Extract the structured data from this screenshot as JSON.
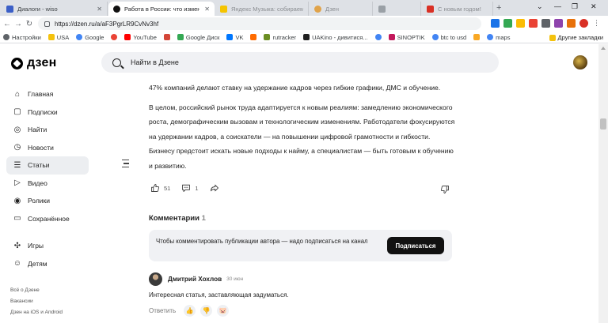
{
  "browser": {
    "tabs": [
      {
        "title": "Диалоги - wiso",
        "active": false
      },
      {
        "title": "Работа в России: что изменилось",
        "active": true
      },
      {
        "title": "Яндекс Музыка: собираем музы",
        "active": false
      },
      {
        "title": "Дзен",
        "active": false
      },
      {
        "title": "",
        "active": false
      },
      {
        "title": "С новым годом!",
        "active": false
      }
    ],
    "new_tab": "+",
    "url": "https://dzen.ru/a/aF3PgrLR9CvNv3hf",
    "bookmarks": [
      "Настройки",
      "USA",
      "Google",
      "",
      "YouTube",
      "",
      "Google Диск",
      "VK",
      "",
      "rutracker",
      "UAKino - дивитися...",
      "",
      "SINOPTIK",
      "btc to usd",
      "",
      "maps"
    ],
    "bookmarks_other": "Другие закладки"
  },
  "header": {
    "logo_text": "дзен",
    "search_placeholder": "Найти в Дзене"
  },
  "sidebar": {
    "items": [
      {
        "label": "Главная",
        "icon": "home-icon"
      },
      {
        "label": "Подписки",
        "icon": "subscriptions-icon"
      },
      {
        "label": "Найти",
        "icon": "compass-icon"
      },
      {
        "label": "Новости",
        "icon": "news-icon"
      },
      {
        "label": "Статьи",
        "icon": "articles-icon",
        "active": true
      },
      {
        "label": "Видео",
        "icon": "video-icon"
      },
      {
        "label": "Ролики",
        "icon": "clips-icon"
      },
      {
        "label": "Сохранённое",
        "icon": "bookmark-icon"
      }
    ],
    "items2": [
      {
        "label": "Игры",
        "icon": "gamepad-icon"
      },
      {
        "label": "Детям",
        "icon": "kids-icon"
      }
    ],
    "footer": [
      "Всё о Дзене",
      "Вакансии",
      "Дзен на iOS и Android"
    ]
  },
  "article": {
    "paragraphs": [
      "47% компаний делают ставку на удержание кадров через гибкие графики, ДМС и обучение.",
      "В целом, российский рынок труда адаптируется к новым реалиям: замедлению экономического роста, демографическим вызовам и технологическим изменениям. Работодатели фокусируются на удержании кадров, а соискатели — на повышении цифровой грамотности и гибкости. Бизнесу предстоит искать новые подходы к найму, а специалистам — быть готовым к обучению и развитию."
    ],
    "likes": "51",
    "comments_count": "1"
  },
  "comments": {
    "title": "Комментарии",
    "count": "1",
    "subscribe_prompt": "Чтобы комментировать публикации автора — надо подписаться на канал",
    "subscribe_button": "Подписаться",
    "items": [
      {
        "author": "Дмитрий Хохлов",
        "date": "30 июн",
        "text": "Интересная статья, заставляющая задуматься.",
        "reply": "Ответить"
      }
    ]
  }
}
